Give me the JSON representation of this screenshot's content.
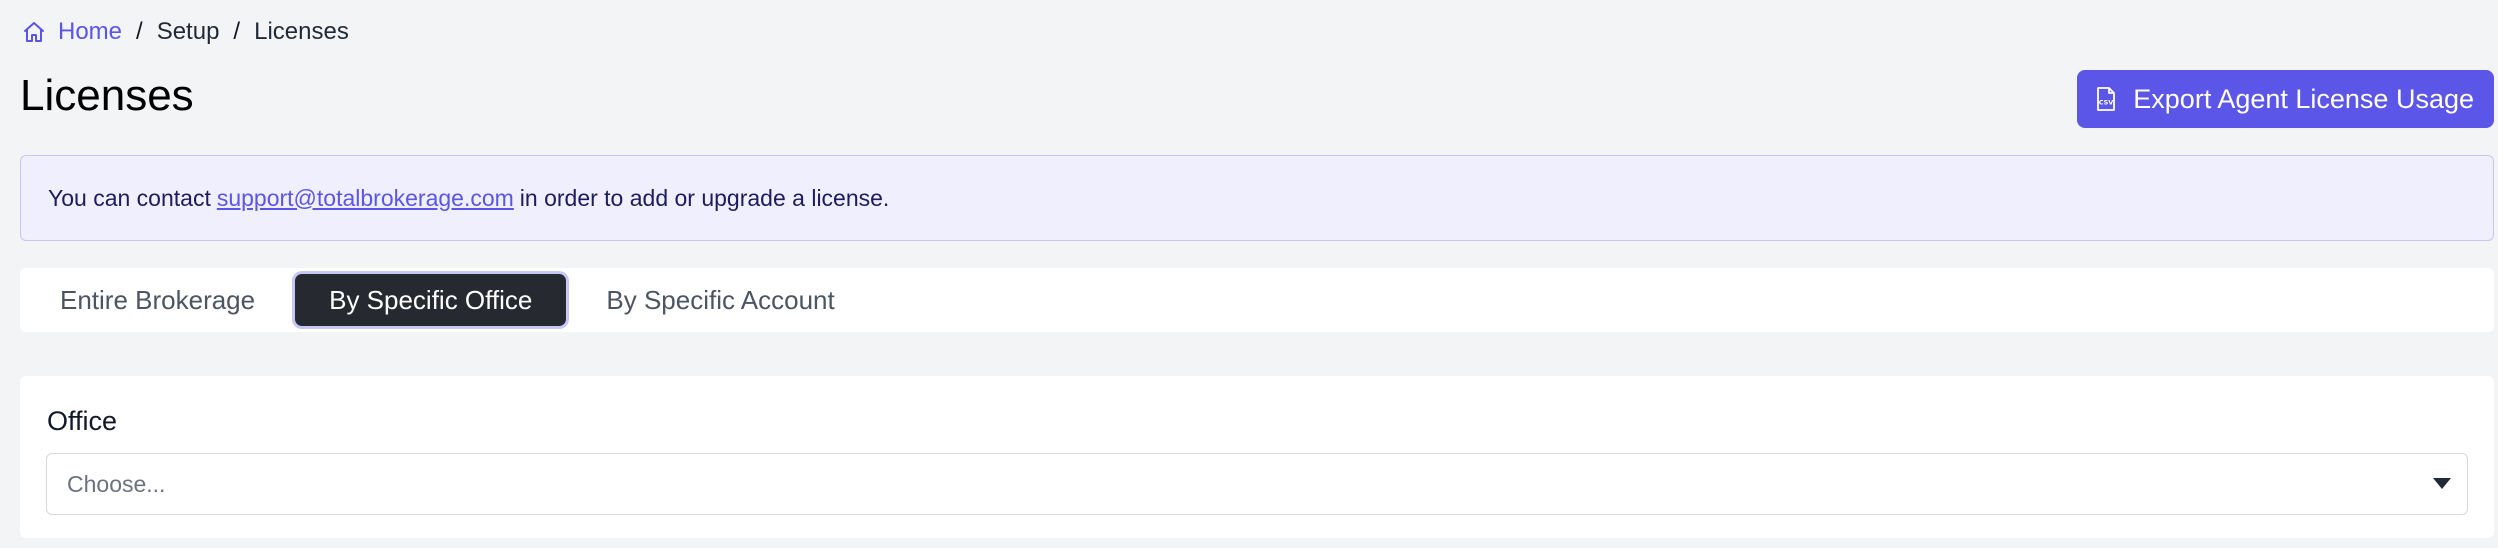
{
  "breadcrumb": {
    "home_icon": "home-icon",
    "home": "Home",
    "separator": "/",
    "setup": "Setup",
    "current": "Licenses"
  },
  "page": {
    "title": "Licenses"
  },
  "export_button": {
    "label": "Export Agent License Usage",
    "icon": "csv-file-icon"
  },
  "alert": {
    "prefix": "You can contact",
    "email": "support@totalbrokerage.com",
    "suffix": "in order to add or upgrade a license."
  },
  "tabs": [
    {
      "label": "Entire Brokerage",
      "active": false
    },
    {
      "label": "By Specific Office",
      "active": true
    },
    {
      "label": "By Specific Account",
      "active": false
    }
  ],
  "office": {
    "label": "Office",
    "placeholder": "Choose..."
  },
  "colors": {
    "accent": "#5b55e8",
    "background": "#f3f4f6",
    "active_tab": "#262a30",
    "alert_background": "#f0effd"
  }
}
